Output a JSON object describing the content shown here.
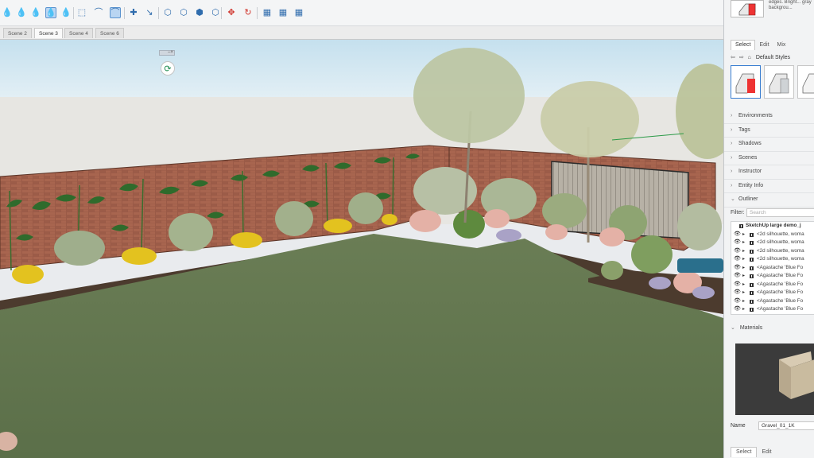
{
  "toolbar": {
    "icons": [
      {
        "name": "paint-drop-outline-icon",
        "glyph": "💧"
      },
      {
        "name": "paint-drop-light-icon",
        "glyph": "💧"
      },
      {
        "name": "paint-drop-blue-icon",
        "glyph": "💧"
      },
      {
        "name": "paint-drop-active-icon",
        "glyph": "💧"
      },
      {
        "name": "paint-drop-pale-icon",
        "glyph": "💧"
      },
      {
        "name": "dashed-select-icon",
        "glyph": "⬚"
      },
      {
        "name": "magnet-icon",
        "glyph": "⌒"
      },
      {
        "name": "magnet-active-icon",
        "glyph": "⌒"
      },
      {
        "name": "add-point-icon",
        "glyph": "✚"
      },
      {
        "name": "connect-line-icon",
        "glyph": "↘"
      },
      {
        "name": "hexagon-outline-icon",
        "glyph": "⬡"
      },
      {
        "name": "hexagon-alt-icon",
        "glyph": "⬡"
      },
      {
        "name": "hexagon-filled-icon",
        "glyph": "⬢"
      },
      {
        "name": "hexagon-small-icon",
        "glyph": "⬡"
      },
      {
        "name": "move-red-icon",
        "glyph": "✥"
      },
      {
        "name": "rotate-red-icon",
        "glyph": "↻"
      },
      {
        "name": "grid-plane-icon",
        "glyph": "▦"
      },
      {
        "name": "grid-plane-alt-icon",
        "glyph": "▦"
      },
      {
        "name": "grid-plane-third-icon",
        "glyph": "▦"
      }
    ]
  },
  "scene_tabs": [
    "Scene 2",
    "Scene 3",
    "Scene 4",
    "Scene 6"
  ],
  "active_scene": "Scene 3",
  "tray": {
    "style_desc": "edges. Bright... gray backgrou...",
    "tabs": [
      "Select",
      "Edit",
      "Mix"
    ],
    "style_name": "Default Styles",
    "sections": [
      {
        "label": "Environments",
        "chevron": "›"
      },
      {
        "label": "Tags",
        "chevron": "›"
      },
      {
        "label": "Shadows",
        "chevron": "›"
      },
      {
        "label": "Scenes",
        "chevron": "›"
      },
      {
        "label": "Instructor",
        "chevron": "›"
      },
      {
        "label": "Entity Info",
        "chevron": "›"
      },
      {
        "label": "Outliner",
        "chevron": "⌄"
      }
    ],
    "filter_label": "Filter:",
    "filter_placeholder": "Search",
    "outliner_root": "SketchUp large demo_j",
    "outliner_rows": [
      "<2d silhouette, woma",
      "<2d silhouette, woma",
      "<2d silhouette, woma",
      "<2d silhouette, woma",
      "<Agastache 'Blue Fo",
      "<Agastache 'Blue Fo",
      "<Agastache 'Blue Fo",
      "<Agastache 'Blue Fo",
      "<Agastache 'Blue Fo",
      "<Agastache 'Blue Fo"
    ],
    "materials_label": "Materials",
    "name_label": "Name",
    "material_name": "Gravel_01_1K",
    "bottom_tabs": [
      "Select",
      "Edit"
    ]
  }
}
